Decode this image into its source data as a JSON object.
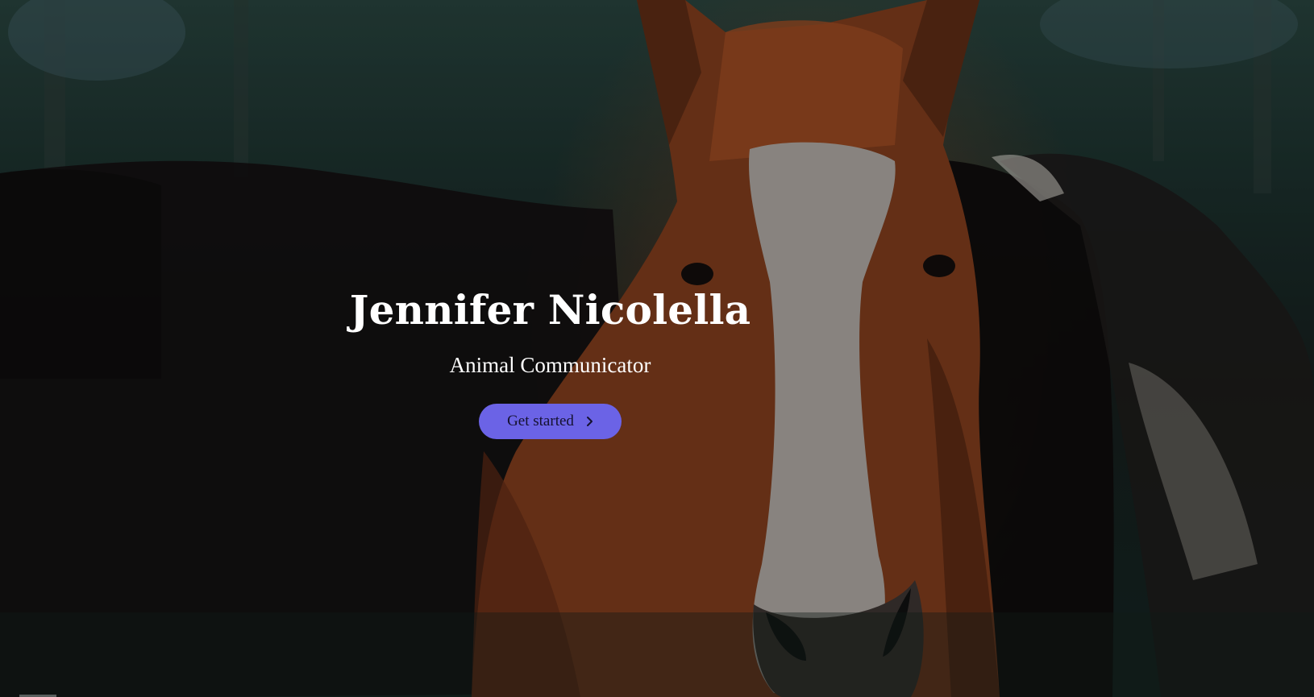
{
  "hero": {
    "title": "Jennifer Nicolella",
    "subtitle": "Animal Communicator",
    "cta_label": "Get started",
    "cta_icon": "chevron-right-icon",
    "background_image": "horses-in-misty-forest"
  },
  "colors": {
    "accent": "#6b63e6",
    "title_text": "#ffffff",
    "cta_text": "#14112e"
  }
}
